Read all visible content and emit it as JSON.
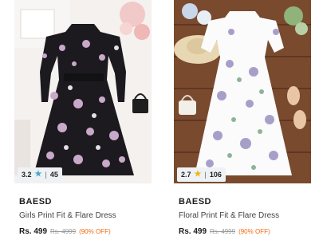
{
  "products": [
    {
      "rating": "3.2",
      "reviews": "45",
      "star_color": "#4aa7c9",
      "brand": "BAESD",
      "title": "Girls Print Fit & Flare Dress",
      "price": "Rs. 499",
      "mrp": "Rs. 4999",
      "discount": "(90% OFF)",
      "image_icon": "black-floral-dress-image"
    },
    {
      "rating": "2.7",
      "reviews": "106",
      "star_color": "#f2b30f",
      "brand": "BAESD",
      "title": "Floral Print Fit & Flare Dress",
      "price": "Rs. 499",
      "mrp": "Rs. 4999",
      "discount": "(90% OFF)",
      "image_icon": "white-floral-dress-image"
    }
  ],
  "colors": {
    "discount": "#f26a10",
    "brand_text": "#1b1b1b"
  }
}
